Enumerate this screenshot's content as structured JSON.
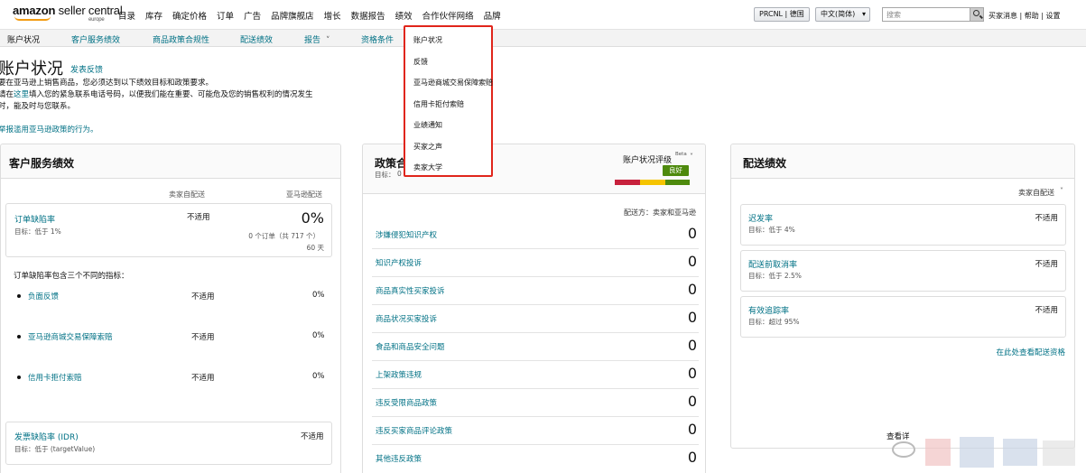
{
  "brand": {
    "name": "amazon",
    "product": "seller central",
    "region": "europe"
  },
  "nav": {
    "items": [
      "目录",
      "库存",
      "确定价格",
      "订单",
      "广告",
      "品牌旗舰店",
      "增长",
      "数据报告",
      "绩效",
      "合作伙伴网络",
      "品牌"
    ],
    "store": "PRCNL | 德国",
    "language": "中文(简体)",
    "search_placeholder": "搜索",
    "links": "买家消息 | 帮助 | 设置"
  },
  "subnav": {
    "items": [
      "账户状况",
      "客户服务绩效",
      "商品政策合规性",
      "配送绩效",
      "报告",
      "资格条件"
    ]
  },
  "dropdown": {
    "items": [
      "账户状况",
      "反馈",
      "亚马逊商城交易保障索赔",
      "信用卡拒付索赔",
      "业绩通知",
      "买家之声",
      "卖家大学"
    ]
  },
  "page": {
    "title": "账户状况",
    "feedback": "发表反馈",
    "intro_1": "要在亚马逊上销售商品，您必须达到以下绩效目标和政策要求。",
    "intro_2_pre": "请在",
    "intro_2_link": "这里",
    "intro_2_post": "填入您的紧急联系电话号码，以便我们能在重要、可能危及您的销售权利的情况发生",
    "intro_3": "时，能及时与您联系。",
    "report_link": "举报滥用亚马逊政策的行为。"
  },
  "customer_service": {
    "title": "客户服务绩效",
    "col_seller": "卖家自配送",
    "col_amazon": "亚马逊配送",
    "odr": {
      "label": "订单缺陷率",
      "target": "目标：低于 1%",
      "seller_value": "不适用",
      "amazon_value": "0%",
      "orders": "0 个订单（共 717 个）",
      "days": "60 天"
    },
    "includes": "订单缺陷率包含三个不同的指标：",
    "metrics": [
      {
        "label": "负面反馈",
        "seller": "不适用",
        "amazon": "0%"
      },
      {
        "label": "亚马逊商城交易保障索赔",
        "seller": "不适用",
        "amazon": "0%"
      },
      {
        "label": "信用卡拒付索赔",
        "seller": "不适用",
        "amazon": "0%"
      }
    ],
    "idr": {
      "label": "发票缺陷率 (IDR)",
      "target": "目标：低于 (targetValue)",
      "value": "不适用"
    }
  },
  "policy": {
    "title": "政策合",
    "target": "目标：",
    "target_value": "0",
    "rating_label": "账户状况评级",
    "beta": "Beta",
    "rating_badge": "良好",
    "fulfilled_by": "配送方：卖家和亚马逊",
    "rows": [
      {
        "label": "涉嫌侵犯知识产权",
        "value": "0"
      },
      {
        "label": "知识产权投诉",
        "value": "0"
      },
      {
        "label": "商品真实性买家投诉",
        "value": "0"
      },
      {
        "label": "商品状况买家投诉",
        "value": "0"
      },
      {
        "label": "食品和商品安全问题",
        "value": "0"
      },
      {
        "label": "上架政策违规",
        "value": "0"
      },
      {
        "label": "违反受限商品政策",
        "value": "0"
      },
      {
        "label": "违反买家商品评论政策",
        "value": "0"
      },
      {
        "label": "其他违反政策",
        "value": "0"
      }
    ],
    "colors": {
      "red": "#c7213d",
      "yellow": "#f5c400",
      "green": "#4e8a0d"
    }
  },
  "delivery": {
    "title": "配送绩效",
    "filter": "卖家自配送",
    "metrics": [
      {
        "label": "迟发率",
        "target": "目标：低于 4%",
        "value": "不适用"
      },
      {
        "label": "配送前取消率",
        "target": "目标：低于 2.5%",
        "value": "不适用"
      },
      {
        "label": "有效追踪率",
        "target": "目标：超过 95%",
        "value": "不适用"
      }
    ],
    "eligibility_link": "在此处查看配送资格",
    "more_link": "查看详"
  }
}
